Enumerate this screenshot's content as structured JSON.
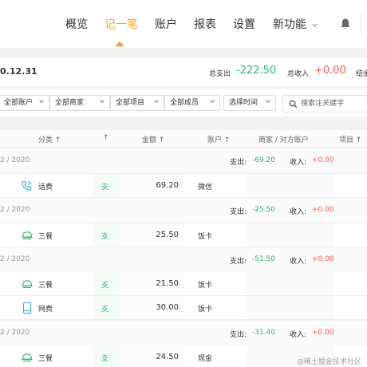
{
  "nav": {
    "items": [
      {
        "label": "概览"
      },
      {
        "label": "记一笔"
      },
      {
        "label": "账户"
      },
      {
        "label": "报表"
      },
      {
        "label": "设置"
      },
      {
        "label": "新功能"
      }
    ],
    "active_index": 1,
    "accent_color": "#f5a623"
  },
  "summary": {
    "date": "0.12.31",
    "total_out_label": "总支出",
    "total_out_value": "-222.50",
    "total_in_label": "总收入",
    "total_in_value": "+0.00",
    "balance_label": "结余"
  },
  "filters": {
    "account": "全部账户",
    "merchant": "全部商家",
    "project": "全部项目",
    "member": "全部成员",
    "time": "选择时间",
    "search_placeholder": "搜索注关键字"
  },
  "table": {
    "headers": {
      "category": "分类 ↑",
      "sort_arrow": "↑",
      "amount": "金额 ↑",
      "account": "账户 ↑",
      "merchant": "商家 / 对方账户",
      "project": "项目 ↑"
    },
    "groups": [
      {
        "date": "2 / 2020",
        "out_label": "支出:",
        "out_value": "-69.20",
        "in_label": "收入:",
        "in_value": "+0.00",
        "rows": [
          {
            "icon": "phone-icon",
            "category": "话费",
            "type": "支",
            "amount": "69.20",
            "account": "微信"
          }
        ]
      },
      {
        "date": "2 / 2020",
        "out_label": "支出:",
        "out_value": "-25.50",
        "in_label": "收入:",
        "in_value": "+0.00",
        "rows": [
          {
            "icon": "meal-icon",
            "category": "三餐",
            "type": "支",
            "amount": "25.50",
            "account": "饭卡"
          }
        ]
      },
      {
        "date": "2 / 2020",
        "out_label": "支出:",
        "out_value": "-51.50",
        "in_label": "收入:",
        "in_value": "+0.00",
        "rows": [
          {
            "icon": "meal-icon",
            "category": "三餐",
            "type": "支",
            "amount": "21.50",
            "account": "饭卡"
          },
          {
            "icon": "device-icon",
            "category": "网费",
            "type": "支",
            "amount": "30.00",
            "account": "饭卡"
          }
        ]
      },
      {
        "date": "2 / 2020",
        "out_label": "支出:",
        "out_value": "-31.40",
        "in_label": "收入:",
        "in_value": "+0.00",
        "rows": [
          {
            "icon": "meal-icon",
            "category": "三餐",
            "type": "支",
            "amount": "24.50",
            "account": "现金"
          }
        ]
      }
    ]
  },
  "colors": {
    "expense": "#2eb872",
    "income": "#ff5a4f",
    "icon": "#3aaee0"
  },
  "watermark": "@稀土掘金技术社区"
}
